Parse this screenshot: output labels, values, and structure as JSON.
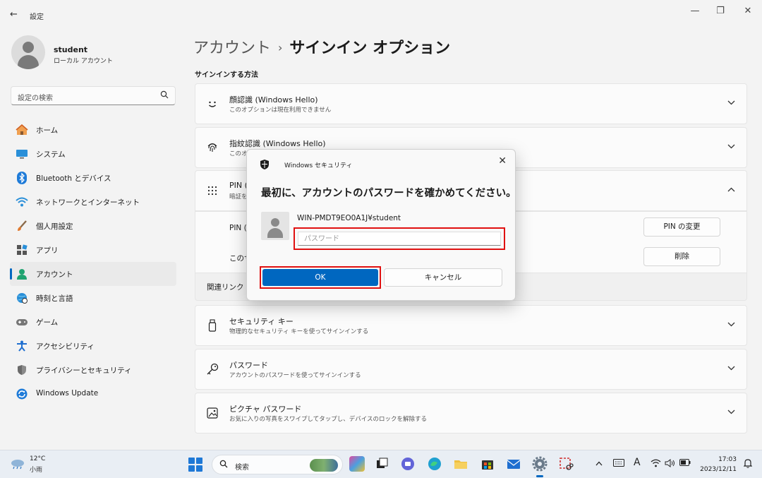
{
  "window": {
    "back_glyph": "←",
    "title": "設定",
    "min_glyph": "—",
    "max_glyph": "❐",
    "close_glyph": "✕"
  },
  "profile": {
    "name": "student",
    "type": "ローカル アカウント"
  },
  "search": {
    "placeholder": "設定の検索",
    "icon": "search-icon"
  },
  "nav": [
    {
      "label": "ホーム",
      "icon": "home-icon",
      "active": false
    },
    {
      "label": "システム",
      "icon": "monitor-icon",
      "active": false
    },
    {
      "label": "Bluetooth とデバイス",
      "icon": "bluetooth-icon",
      "active": false
    },
    {
      "label": "ネットワークとインターネット",
      "icon": "wifi-icon",
      "active": false
    },
    {
      "label": "個人用設定",
      "icon": "brush-icon",
      "active": false
    },
    {
      "label": "アプリ",
      "icon": "apps-icon",
      "active": false
    },
    {
      "label": "アカウント",
      "icon": "person-icon",
      "active": true
    },
    {
      "label": "時刻と言語",
      "icon": "globe-clock-icon",
      "active": false
    },
    {
      "label": "ゲーム",
      "icon": "gamepad-icon",
      "active": false
    },
    {
      "label": "アクセシビリティ",
      "icon": "accessibility-icon",
      "active": false
    },
    {
      "label": "プライバシーとセキュリティ",
      "icon": "shield-icon",
      "active": false
    },
    {
      "label": "Windows Update",
      "icon": "update-icon",
      "active": false
    }
  ],
  "breadcrumb": {
    "parent": "アカウント",
    "separator": "›",
    "current": "サインイン オプション"
  },
  "section_title": "サインインする方法",
  "cards": {
    "face": {
      "title": "顔認識 (Windows Hello)",
      "subtitle": "このオプションは現在利用できません",
      "icon": "face-icon"
    },
    "finger": {
      "title": "指紋認識 (Windows Hello)",
      "subtitle": "このオ",
      "icon": "fingerprint-icon"
    },
    "pin": {
      "title": "PIN (",
      "subtitle": "暗証を",
      "icon": "keypad-icon"
    },
    "pin_change_label": "PIN (",
    "pin_change_button": "PIN の変更",
    "pin_remove_label": "このサ",
    "pin_remove_button": "削除",
    "related": "関連リンク",
    "security_key": {
      "title": "セキュリティ キー",
      "subtitle": "物理的なセキュリティ キーを使ってサインインする",
      "icon": "usb-key-icon"
    },
    "password": {
      "title": "パスワード",
      "subtitle": "アカウントのパスワードを使ってサインインする",
      "icon": "key-icon"
    },
    "picture": {
      "title": "ピクチャ パスワード",
      "subtitle": "お気に入りの写真をスワイプしてタップし、デバイスのロックを解除する",
      "icon": "picture-icon"
    }
  },
  "dialog": {
    "title": "Windows セキュリティ",
    "heading": "最初に、アカウントのパスワードを確かめてください。",
    "account": "WIN-PMDT9EO0A1J¥student",
    "password_placeholder": "パスワード",
    "ok": "OK",
    "cancel": "キャンセル",
    "close_glyph": "✕"
  },
  "taskbar": {
    "temp": "12°C",
    "weather": "小雨",
    "search_label": "検索",
    "ime": "A",
    "time": "17:03",
    "date": "2023/12/11"
  },
  "colors": {
    "accent": "#0067c0",
    "highlight": "#e01010"
  }
}
